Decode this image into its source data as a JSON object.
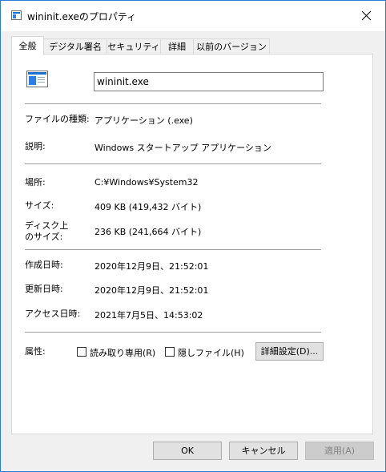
{
  "window": {
    "title": "wininit.exeのプロパティ"
  },
  "tabs": [
    {
      "label": "全般"
    },
    {
      "label": "デジタル署名"
    },
    {
      "label": "セキュリティ"
    },
    {
      "label": "詳細"
    },
    {
      "label": "以前のバージョン"
    }
  ],
  "general": {
    "file_name": "wininit.exe",
    "file_type_label": "ファイルの種類:",
    "file_type_value": "アプリケーション (.exe)",
    "description_label": "説明:",
    "description_value": "Windows スタートアップ アプリケーション",
    "location_label": "場所:",
    "location_value": "C:¥Windows¥System32",
    "size_label": "サイズ:",
    "size_value": "409 KB (419,432 バイト)",
    "size_on_disk_label_line1": "ディスク上",
    "size_on_disk_label_line2": "のサイズ:",
    "size_on_disk_value": "236 KB (241,664 バイト)",
    "created_label": "作成日時:",
    "created_value": "2020年12月9日、21:52:01",
    "modified_label": "更新日時:",
    "modified_value": "2020年12月9日、21:52:01",
    "accessed_label": "アクセス日時:",
    "accessed_value": "2021年7月5日、14:53:02",
    "attributes_label": "属性:",
    "readonly_label": "読み取り専用(R)",
    "readonly_checked": false,
    "hidden_label": "隠しファイル(H)",
    "hidden_checked": false,
    "advanced_button": "詳細設定(D)..."
  },
  "buttons": {
    "ok": "OK",
    "cancel": "キャンセル",
    "apply": "適用(A)"
  },
  "colors": {
    "window_border": "#2b79d8",
    "dialog_bg": "#f0f0f0",
    "panel_bg": "#ffffff",
    "icon_blue": "#1f6fd0"
  }
}
